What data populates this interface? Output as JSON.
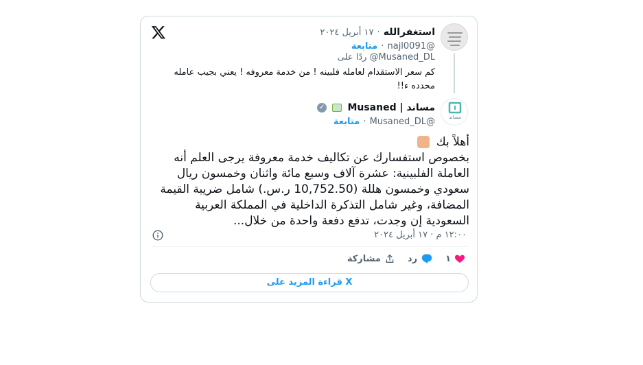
{
  "quoted": {
    "name": "استغفرالله",
    "separator": "·",
    "date": "١٧ أبريل ٢٠٢٤",
    "handle": "@najl0091",
    "follow_label": "متابعة",
    "reply_to": "ردًا على @Musaned_DL",
    "text": "كم سعر الاستقدام لعامله فلبينه ! من خدمة معروفه ! يعني بجيب عامله محدده ء!!"
  },
  "main": {
    "name": "مساند | Musaned",
    "handle": "@Musaned_DL",
    "follow_label": "متابعة",
    "avatar_text": "مساند",
    "greeting": "أهلاً بك",
    "text": "بخصوص استفسارك عن تكاليف خدمة معروفة  يرجى العلم أنه العاملة الفلبينية: عشرة آلاف وسبع مائة واثنان وخمسون ريال سعودي وخمسون هللة (10,752.50 ر.س.) شامل ضريبة القيمة المضافة، وغير شامل التذكرة الداخلية في المملكة العربية السعودية إن وجدت، تدفع دفعة واحدة من خلال...",
    "timestamp": "١٢:٠٠ م · ١٧ أبريل ٢٠٢٤"
  },
  "actions": {
    "like_count": "١",
    "reply_label": "رد",
    "share_label": "مشاركة"
  },
  "read_more": "قراءة المزيد على X",
  "colors": {
    "accent": "#1d9bf0",
    "heart": "#f91880",
    "muted": "#536471",
    "border": "#cfd9de"
  }
}
